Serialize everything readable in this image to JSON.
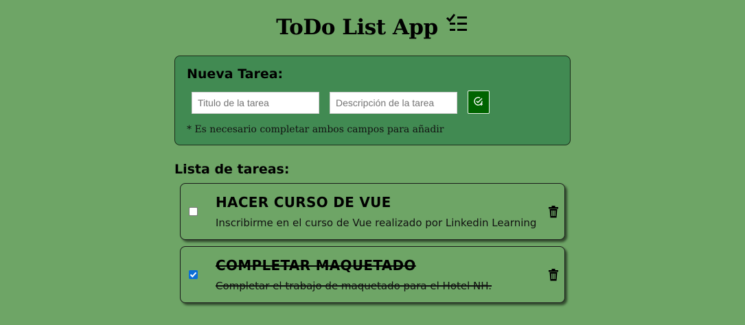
{
  "header": {
    "title": "ToDo List App",
    "icon": "checklist-icon"
  },
  "new_task": {
    "heading": "Nueva Tarea:",
    "title_placeholder": "Titulo de la tarea",
    "description_placeholder": "Descripción de la tarea",
    "add_icon": "add-task-icon",
    "hint": "* Es necesario completar ambos campos para añadir"
  },
  "list": {
    "heading": "Lista de tareas:",
    "tasks": [
      {
        "title": "HACER CURSO DE VUE",
        "description": "Inscribirme en el curso de Vue realizado por Linkedin Learning",
        "completed": false
      },
      {
        "title": "COMPLETAR MAQUETADO",
        "description": "Completar el trabajo de maquetado para el Hotel NH.",
        "completed": true
      }
    ]
  },
  "colors": {
    "background": "#6ea566",
    "card": "#418a52",
    "button": "#006400",
    "checkbox": "#0b6ed6"
  }
}
